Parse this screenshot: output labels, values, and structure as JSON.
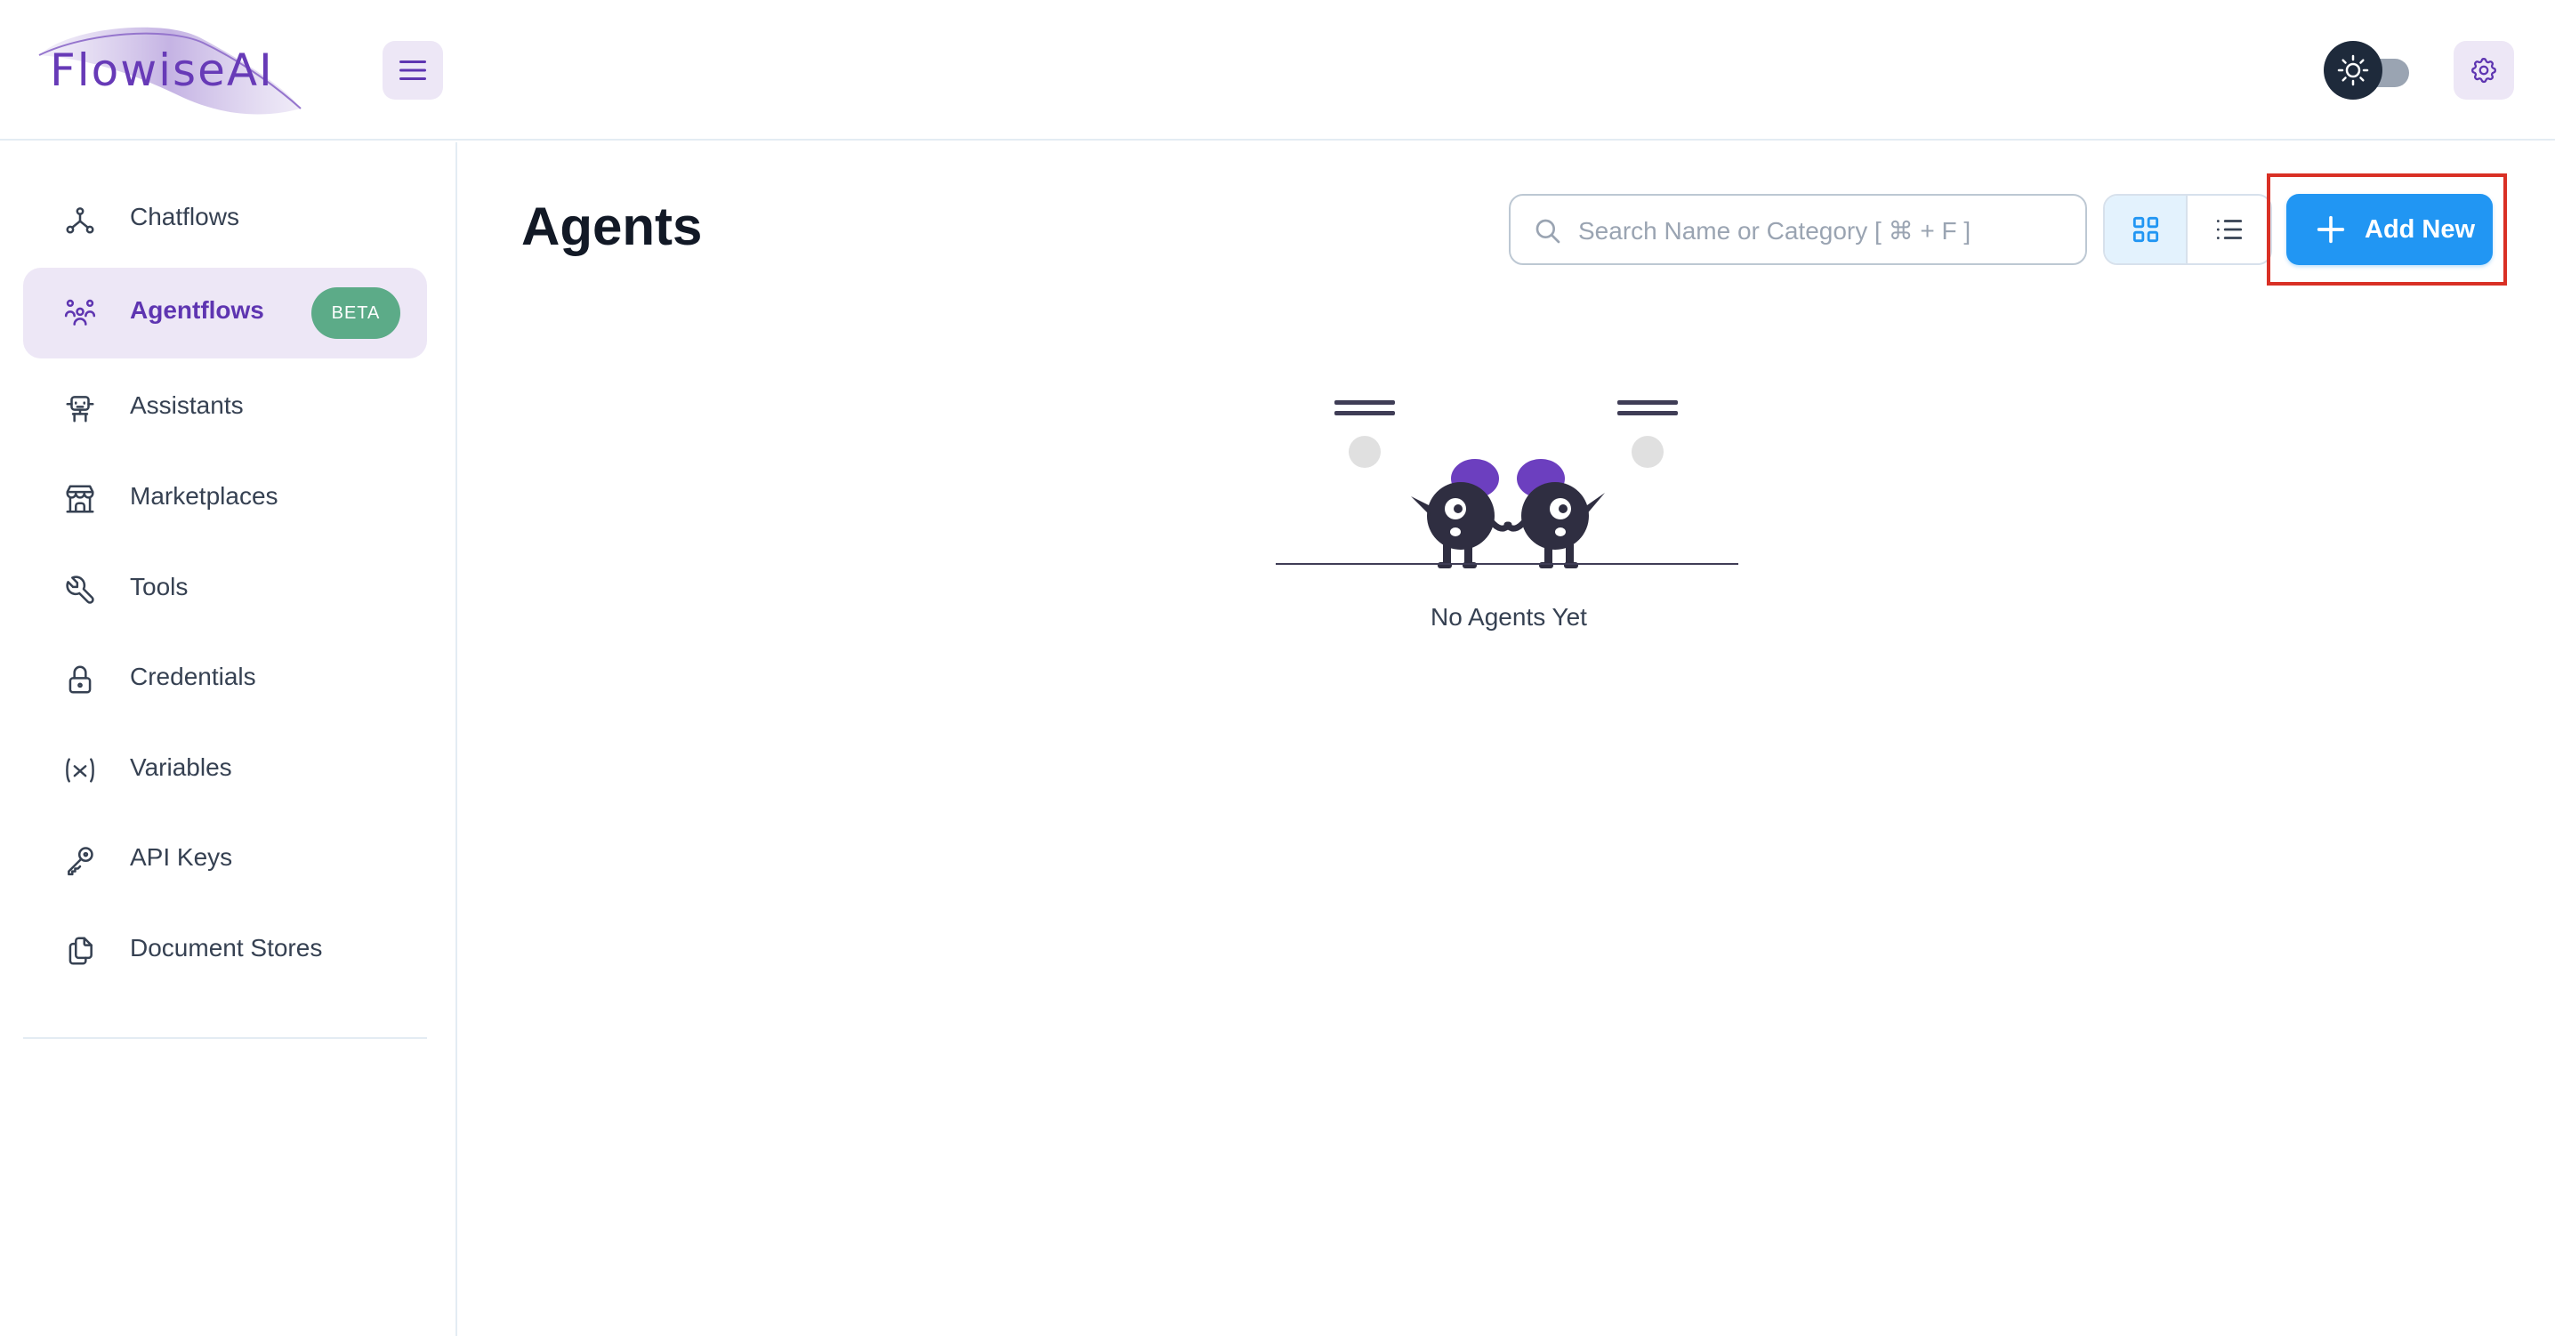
{
  "brand": {
    "name": "FlowiseAI",
    "accent": "#673ab7"
  },
  "header": {
    "menu_icon": "hamburger-menu-icon",
    "theme_icon": "sun-icon",
    "settings_icon": "gear-icon"
  },
  "sidebar": {
    "items": [
      {
        "label": "Chatflows",
        "icon": "nodes-icon"
      },
      {
        "label": "Agentflows",
        "icon": "users-group-icon",
        "badge": "BETA",
        "active": true
      },
      {
        "label": "Assistants",
        "icon": "robot-icon"
      },
      {
        "label": "Marketplaces",
        "icon": "storefront-icon"
      },
      {
        "label": "Tools",
        "icon": "wrench-icon"
      },
      {
        "label": "Credentials",
        "icon": "lock-icon"
      },
      {
        "label": "Variables",
        "icon": "variable-icon"
      },
      {
        "label": "API Keys",
        "icon": "key-icon"
      },
      {
        "label": "Document Stores",
        "icon": "files-icon"
      }
    ]
  },
  "main": {
    "title": "Agents",
    "search": {
      "placeholder": "Search Name or Category [ ⌘ + F ]",
      "value": ""
    },
    "view_toggle": {
      "selected": "grid"
    },
    "add_button_label": "Add New",
    "empty_state_text": "No Agents Yet"
  }
}
